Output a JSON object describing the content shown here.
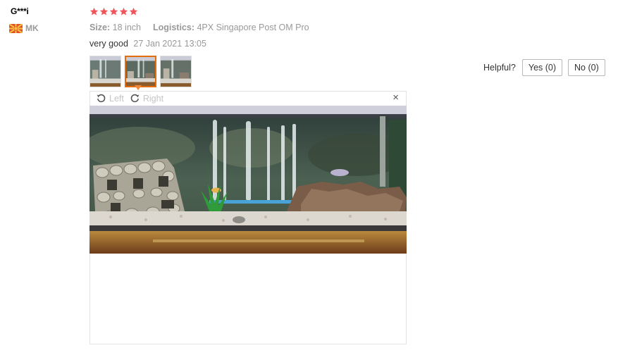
{
  "review": {
    "user_name": "G***i",
    "country_code": "MK",
    "rating": 5,
    "size_label": "Size:",
    "size_value": "18 inch",
    "logistics_label": "Logistics:",
    "logistics_value": "4PX Singapore Post OM Pro",
    "comment": "very good",
    "date": "27 Jan 2021 13:05",
    "thumbnails_count": 3,
    "active_thumbnail": 2
  },
  "helpful": {
    "label": "Helpful?",
    "yes_label": "Yes (0)",
    "no_label": "No (0)"
  },
  "viewer": {
    "rotate_left_label": "Left",
    "rotate_right_label": "Right",
    "close_glyph": "×"
  },
  "colors": {
    "star": "#f0555a",
    "active_thumb_border": "#e46c0a",
    "muted_text": "#999999"
  },
  "icons": {
    "flag": "macedonia-flag-icon",
    "star": "star-icon",
    "rotate_left": "rotate-left-icon",
    "rotate_right": "rotate-right-icon",
    "close": "close-icon"
  }
}
